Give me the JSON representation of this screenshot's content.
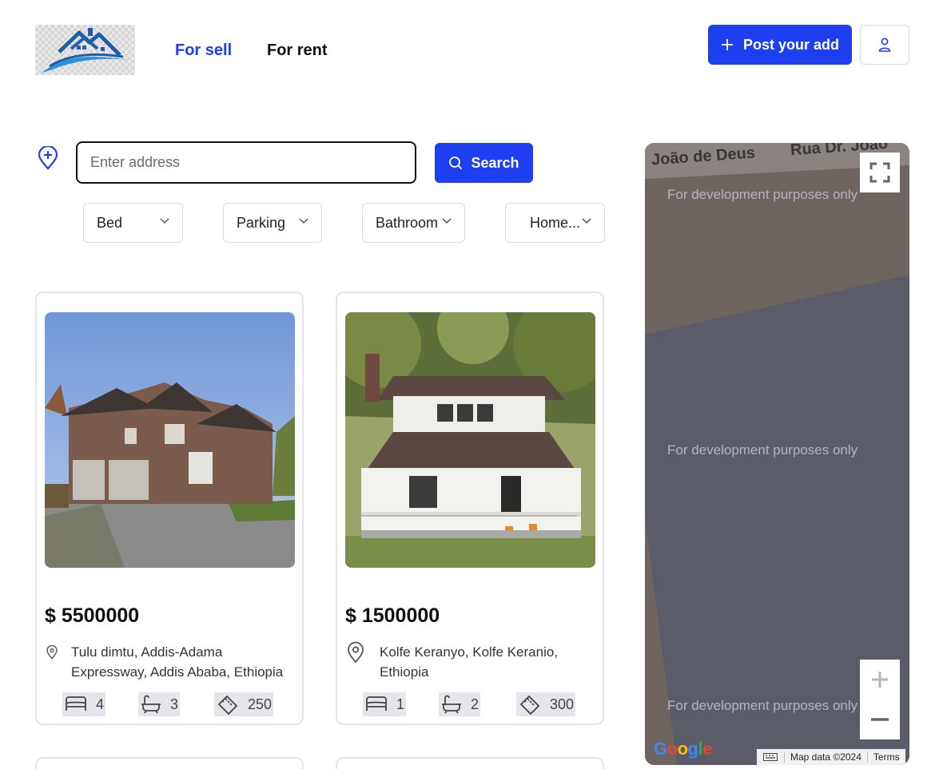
{
  "header": {
    "nav": {
      "sell": "For sell",
      "rent": "For rent"
    },
    "post_button": "Post your add"
  },
  "search": {
    "placeholder": "Enter address",
    "button": "Search"
  },
  "filters": [
    "Bed",
    "Parking",
    "Bathroom",
    "Home..."
  ],
  "listings": [
    {
      "price": "$ 5500000",
      "address": "Tulu dimtu, Addis-Adama Expressway, Addis Ababa, Ethiopia",
      "beds": "4",
      "baths": "3",
      "area": "250"
    },
    {
      "price": "$ 1500000",
      "address": "Kolfe Keranyo, Kolfe Keranio, Ethiopia",
      "beds": "1",
      "baths": "2",
      "area": "300"
    }
  ],
  "map": {
    "street_1": "João de Deus",
    "street_2": "Rua Dr. João",
    "watermark": "For development purposes only",
    "google": "Google",
    "map_data": "Map data ©2024",
    "terms": "Terms"
  },
  "colors": {
    "accent": "#1d3ff0",
    "map_bg": "#5a5d68",
    "map_road": "#6e6460"
  }
}
